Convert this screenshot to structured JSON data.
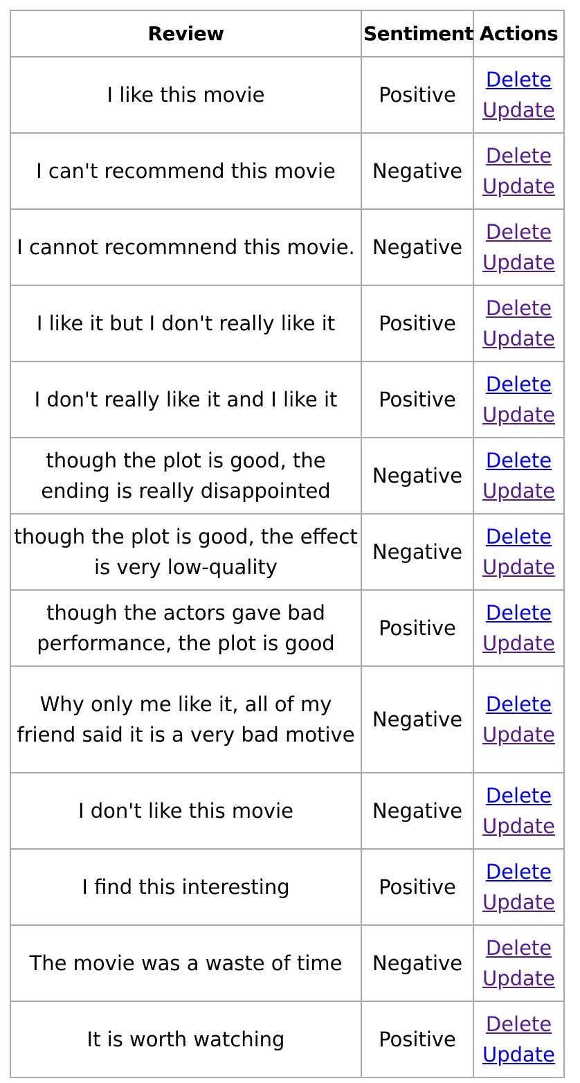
{
  "table": {
    "headers": {
      "review": "Review",
      "sentiment": "Sentiment",
      "actions": "Actions"
    },
    "rows": [
      {
        "review": "I like this movie",
        "sentiment": "Positive",
        "delete_label": "Delete",
        "update_label": "Update"
      },
      {
        "review": "I can't recommend this movie",
        "sentiment": "Negative",
        "delete_label": "Delete",
        "update_label": "Update"
      },
      {
        "review": "I cannot recommnend this movie.",
        "sentiment": "Negative",
        "delete_label": "Delete",
        "update_label": "Update"
      },
      {
        "review": "I like it but I don't really like it",
        "sentiment": "Positive",
        "delete_label": "Delete",
        "update_label": "Update"
      },
      {
        "review": "I don't really like it and I like it",
        "sentiment": "Positive",
        "delete_label": "Delete",
        "update_label": "Update"
      },
      {
        "review": "though the plot is good, the ending is really disappointed",
        "sentiment": "Negative",
        "delete_label": "Delete",
        "update_label": "Update"
      },
      {
        "review": "though the plot is good, the effect is very low-quality",
        "sentiment": "Negative",
        "delete_label": "Delete",
        "update_label": "Update"
      },
      {
        "review": "though the actors gave bad performance, the plot is good",
        "sentiment": "Positive",
        "delete_label": "Delete",
        "update_label": "Update"
      },
      {
        "review": "Why only me like it, all of my friend said it is a very bad motive",
        "sentiment": "Negative",
        "delete_label": "Delete",
        "update_label": "Update"
      },
      {
        "review": "I don't like this movie",
        "sentiment": "Negative",
        "delete_label": "Delete",
        "update_label": "Update"
      },
      {
        "review": "I find this interesting",
        "sentiment": "Positive",
        "delete_label": "Delete",
        "update_label": "Update"
      },
      {
        "review": "The movie was a waste of time",
        "sentiment": "Negative",
        "delete_label": "Delete",
        "update_label": "Update"
      },
      {
        "review": "It is worth watching",
        "sentiment": "Positive",
        "delete_label": "Delete",
        "update_label": "Update"
      }
    ]
  },
  "colors": {
    "link_unvisited": "#0000ee",
    "link_visited": "#551a8b",
    "border": "#a9a9a9"
  }
}
